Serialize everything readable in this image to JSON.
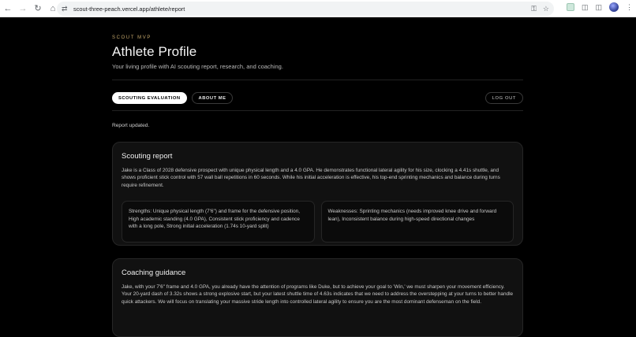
{
  "browser": {
    "url": "scout-three-peach.vercel.app/athlete/report"
  },
  "header": {
    "eyebrow": "SCOUT MVP",
    "title": "Athlete Profile",
    "subtitle": "Your living profile with AI scouting report, research, and coaching."
  },
  "tabs": [
    {
      "label": "SCOUTING EVALUATION",
      "active": true
    },
    {
      "label": "ABOUT ME",
      "active": false
    }
  ],
  "logout_label": "LOG OUT",
  "status_text": "Report updated.",
  "scouting_report": {
    "heading": "Scouting report",
    "summary": "Jake is a Class of 2028 defensive prospect with unique physical length and a 4.0 GPA. He demonstrates functional lateral agility for his size, clocking a 4.41s shuttle, and shows proficient stick control with 57 wall ball repetitions in 60 seconds. While his initial acceleration is effective, his top-end sprinting mechanics and balance during turns require refinement.",
    "strengths": "Strengths: Unique physical length (7'6\") and frame for the defensive position, High academic standing (4.0 GPA), Consistent stick proficiency and cadence with a long pole, Strong initial acceleration (1.74s 10-yard split)",
    "weaknesses": "Weaknesses: Sprinting mechanics (needs improved knee drive and forward lean), Inconsistent balance during high-speed directional changes"
  },
  "coaching_guidance": {
    "heading": "Coaching guidance",
    "body": "Jake, with your 7'6\" frame and 4.0 GPA, you already have the attention of programs like Duke, but to achieve your goal to 'Win,' we must sharpen your movement efficiency. Your 20-yard dash of 3.32s shows a strong explosive start, but your latest shuttle time of 4.63s indicates that we need to address the overstepping at your turns to better handle quick attackers. We will focus on translating your massive stride length into controlled lateral agility to ensure you are the most dominant defenseman on the field."
  },
  "colors": {
    "background": "#000000",
    "accent": "#c2a56a",
    "card": "#111111"
  }
}
